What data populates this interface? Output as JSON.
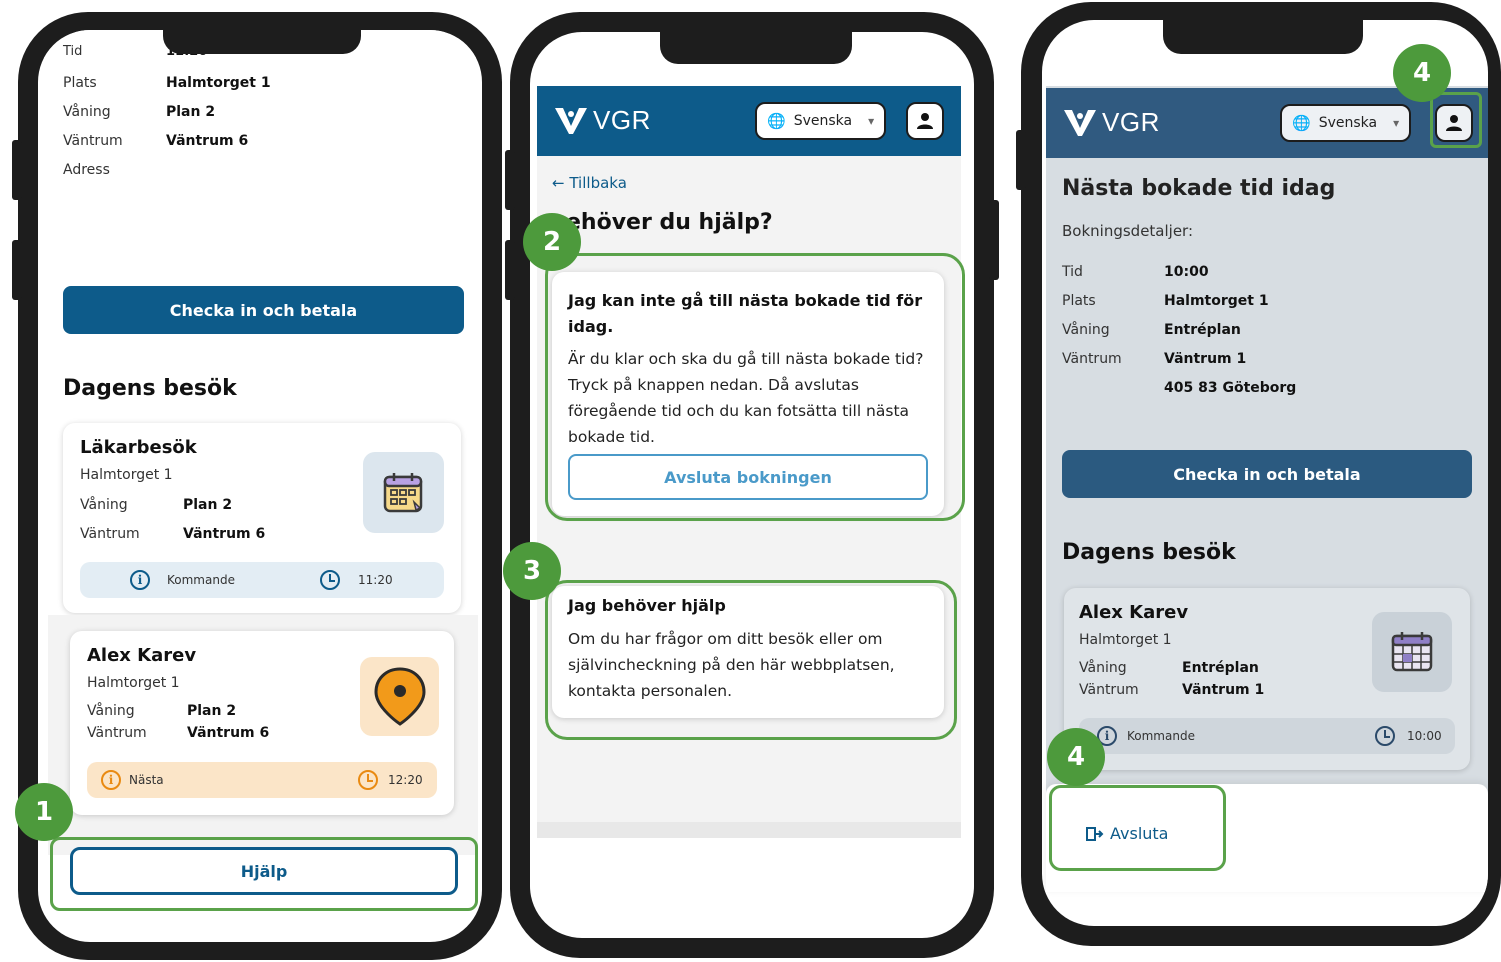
{
  "phone1": {
    "cut_tid": "Tid",
    "cut_tid_value": "11:20",
    "details": [
      {
        "label": "Plats",
        "value": "Halmtorget 1"
      },
      {
        "label": "Våning",
        "value": "Plan 2"
      },
      {
        "label": "Väntrum",
        "value": "Väntrum 6"
      },
      {
        "label": "Adress",
        "value": ""
      }
    ],
    "checkin_label": "Checka in och betala",
    "section_title": "Dagens besök",
    "card1": {
      "title": "Läkarbesök",
      "subtitle": "Halmtorget 1",
      "vaning_label": "Våning",
      "vaning_value": "Plan 2",
      "vantrum_label": "Väntrum",
      "vantrum_value": "Väntrum 6",
      "status": "Kommande",
      "time": "11:20"
    },
    "card2": {
      "title": "Alex Karev",
      "subtitle": "Halmtorget 1",
      "vaning_label": "Våning",
      "vaning_value": "Plan 2",
      "vantrum_label": "Väntrum",
      "vantrum_value": "Väntrum 6",
      "status": "Nästa",
      "time": "12:20"
    },
    "help_label": "Hjälp",
    "badge": "1"
  },
  "phone2": {
    "logo": "VGR",
    "language": "Svenska",
    "back_label": "Tillbaka",
    "heading": "ehöver du hjälp?",
    "box1": {
      "title": "Jag kan inte gå till nästa bokade tid för idag.",
      "text": "Är du klar och ska du gå till nästa bokade tid? Tryck på knappen nedan. Då avslutas föregående tid och du kan fotsätta till nästa bokade tid.",
      "button": "Avsluta bokningen"
    },
    "box2": {
      "title": "Jag behöver hjälp",
      "text": "Om du har frågor om ditt besök eller om självincheckning på den här webbplatsen, kontakta personalen."
    },
    "badge2": "2",
    "badge3": "3"
  },
  "phone3": {
    "logo": "VGR",
    "language": "Svenska",
    "title": "Nästa bokade tid idag",
    "subtitle": "Bokningsdetaljer:",
    "details": [
      {
        "label": "Tid",
        "value": "10:00"
      },
      {
        "label": "Plats",
        "value": "Halmtorget 1"
      },
      {
        "label": "Våning",
        "value": "Entréplan"
      },
      {
        "label": "Väntrum",
        "value": "Väntrum 1"
      },
      {
        "label": "",
        "value": "405 83 Göteborg"
      }
    ],
    "checkin_label": "Checka in och betala",
    "section_title": "Dagens besök",
    "card": {
      "title": "Alex Karev",
      "subtitle": "Halmtorget 1",
      "vaning_label": "Våning",
      "vaning_value": "Entréplan",
      "vantrum_label": "Väntrum",
      "vantrum_value": "Väntrum 1",
      "status": "Kommande",
      "time": "10:00"
    },
    "menu_item": "Avsluta",
    "badge_top": "4",
    "badge_bottom": "4"
  },
  "colors": {
    "brand": "#0d5b8a",
    "highlight": "#5aa24a",
    "badge": "#4d9a3c",
    "next_status": "#fbe5c8",
    "pin": "#f29a1a"
  }
}
